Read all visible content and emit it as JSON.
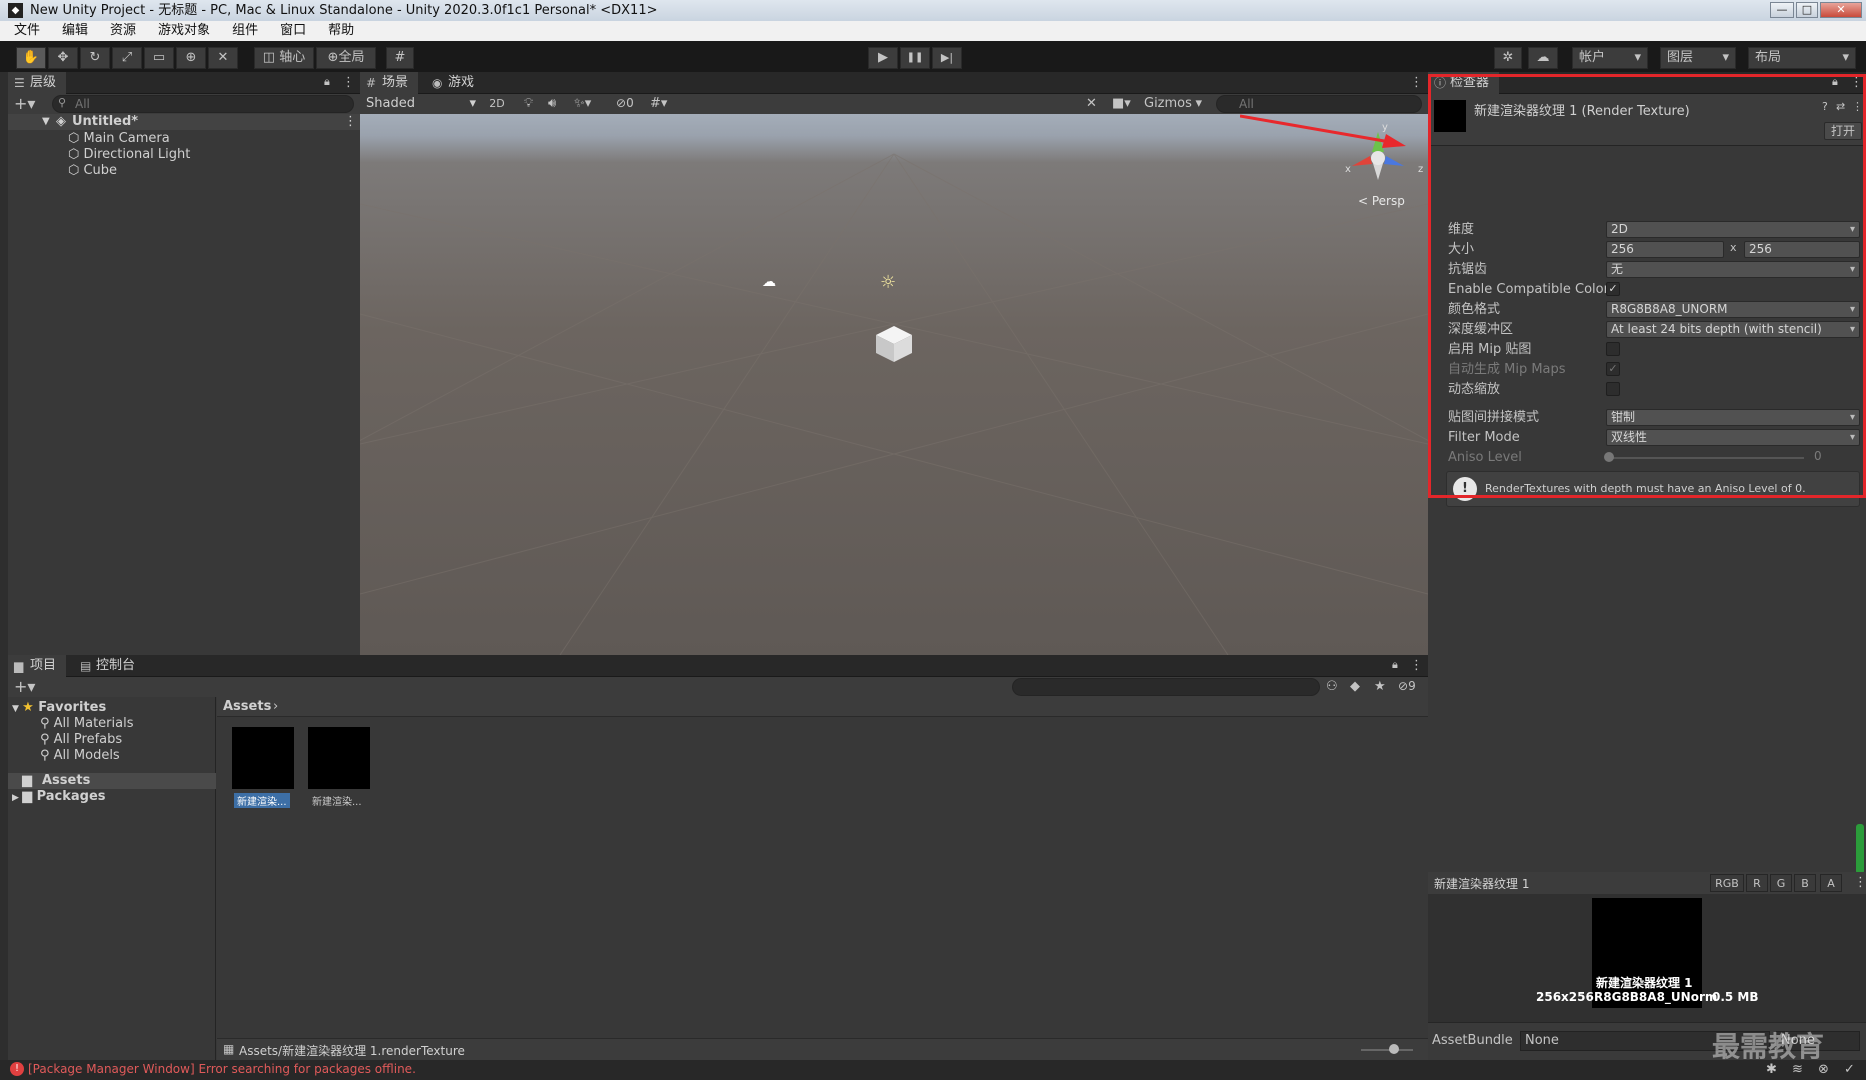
{
  "window": {
    "title": "New Unity Project - 无标题 - PC, Mac & Linux Standalone - Unity 2020.3.0f1c1 Personal* <DX11>",
    "icon": "unity-icon",
    "min": "—",
    "max": "□",
    "close": "✕"
  },
  "menu": [
    "文件",
    "编辑",
    "资源",
    "游戏对象",
    "组件",
    "窗口",
    "帮助"
  ],
  "toolbar": {
    "tools": [
      "hand-tool-icon",
      "move-tool-icon",
      "rotate-tool-icon",
      "scale-tool-icon",
      "rect-tool-icon",
      "transform-tool-icon",
      "custom-tool-icon"
    ],
    "pivot": "轴心",
    "global": "全局",
    "play": "▶",
    "pause": "❚❚",
    "step": "▶|",
    "account": "帐户",
    "layers": "图层",
    "layout": "布局"
  },
  "hierarchy": {
    "tab": "层级",
    "search_placeholder": "All",
    "scene": "Untitled*",
    "items": [
      "Main Camera",
      "Directional Light",
      "Cube"
    ]
  },
  "scene": {
    "tabs": [
      "场景",
      "游戏"
    ],
    "shading": "Shaded",
    "mode2d": "2D",
    "hidden_count": "0",
    "gizmos": "Gizmos",
    "search_placeholder": "All",
    "persp": "< Persp",
    "axis_x": "x",
    "axis_z": "z",
    "axis_y": "y"
  },
  "inspector": {
    "tab": "检查器",
    "asset_title": "新建渲染器纹理 1 (Render Texture)",
    "open": "打开",
    "rows": [
      {
        "label": "维度",
        "value": "2D",
        "type": "dropdown"
      },
      {
        "label": "大小",
        "value": "256",
        "value2": "256",
        "type": "size"
      },
      {
        "label": "抗锯齿",
        "value": "无",
        "type": "dropdown"
      },
      {
        "label": "Enable Compatible Color F",
        "value": "✓",
        "type": "check"
      },
      {
        "label": "颜色格式",
        "value": "R8G8B8A8_UNORM",
        "type": "dropdown"
      },
      {
        "label": "深度缓冲区",
        "value": "At least 24 bits depth (with stencil)",
        "type": "dropdown"
      },
      {
        "label": "启用 Mip 贴图",
        "value": "",
        "type": "check"
      },
      {
        "label": "自动生成 Mip Maps",
        "value": "✓",
        "type": "check",
        "disabled": true
      },
      {
        "label": "动态缩放",
        "value": "",
        "type": "check"
      },
      {
        "label": "贴图间拼接模式",
        "value": "钳制",
        "type": "dropdown"
      },
      {
        "label": "Filter Mode",
        "value": "双线性",
        "type": "dropdown"
      },
      {
        "label": "Aniso Level",
        "value": "0",
        "type": "slider",
        "disabled": true
      }
    ],
    "warning": "RenderTextures with depth must have an Aniso Level of 0.",
    "size_sep": "x"
  },
  "preview": {
    "title": "新建渲染器纹理 1",
    "channels": [
      "RGB",
      "R",
      "G",
      "B",
      "A"
    ],
    "name": "新建渲染器纹理 1",
    "dims": "256x256",
    "format": "R8G8B8A8_UNorm",
    "size": "0.5 MB",
    "assetbundle_label": "AssetBundle",
    "assetbundle_value": "None",
    "assetbundle_variant": "None"
  },
  "project": {
    "tabs": [
      "项目",
      "控制台"
    ],
    "favorites": "Favorites",
    "fav_items": [
      "All Materials",
      "All Prefabs",
      "All Models"
    ],
    "assets": "Assets",
    "packages": "Packages",
    "breadcrumb": "Assets",
    "hidden_count": "9",
    "files": [
      "新建渲染...",
      "新建渲染..."
    ],
    "path": "Assets/新建渲染器纹理 1.renderTexture"
  },
  "status": {
    "error": "[Package Manager Window] Error searching for packages offline."
  },
  "watermark": "最需教育"
}
